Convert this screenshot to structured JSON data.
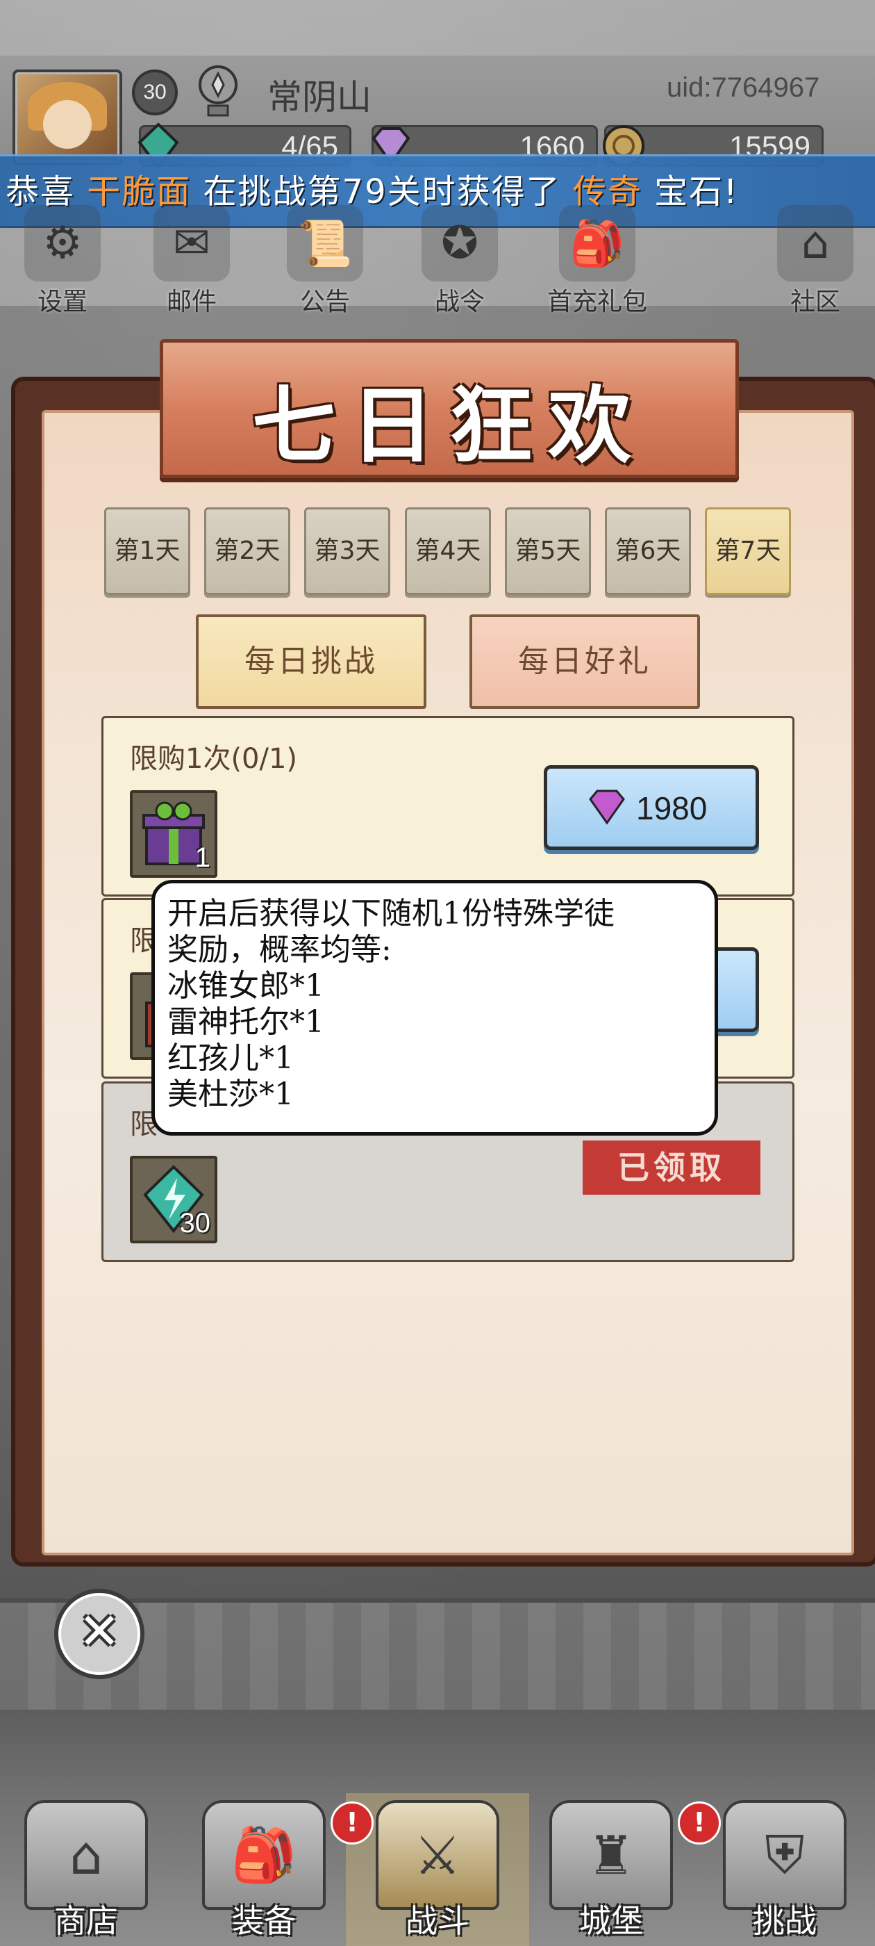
{
  "player": {
    "level": "30",
    "name": "常阴山",
    "uid": "uid:7764967"
  },
  "resources": {
    "energy": "4/65",
    "gems": "1660",
    "coins": "15599"
  },
  "banner": {
    "prefix": "恭喜 ",
    "player_name": "干脆面",
    "middle": " 在挑战第79关时获得了 ",
    "rarity": "传奇",
    "suffix": " 宝石!"
  },
  "top_menu": [
    {
      "label": "设置",
      "icon": "gear-icon"
    },
    {
      "label": "邮件",
      "icon": "mail-icon"
    },
    {
      "label": "公告",
      "icon": "scroll-icon"
    },
    {
      "label": "战令",
      "icon": "battle-pass-icon"
    },
    {
      "label": "首充礼包",
      "icon": "gift-bag-icon"
    },
    {
      "label": "社区",
      "icon": "home-icon"
    }
  ],
  "modal": {
    "title": "七日狂欢",
    "days": [
      "第1天",
      "第2天",
      "第3天",
      "第4天",
      "第5天",
      "第6天",
      "第7天"
    ],
    "active_day": "第7天",
    "subtabs": [
      "每日挑战",
      "每日好礼"
    ],
    "items": [
      {
        "title": "限购1次(0/1)",
        "count": "1",
        "price": "1980",
        "icon": "purple-gift-box-icon"
      },
      {
        "title": "限",
        "icon": "red-gift-box-icon"
      },
      {
        "title": "限",
        "count": "30",
        "status": "已领取",
        "icon": "energy-crystal-icon"
      }
    ]
  },
  "tooltip": {
    "lines": [
      "开启后获得以下随机1份特殊学徒",
      "奖励，概率均等:",
      "冰锥女郎*1",
      "雷神托尔*1",
      "红孩儿*1",
      "美杜莎*1"
    ]
  },
  "bottom_nav": [
    {
      "label": "商店",
      "icon": "shop-hut-icon"
    },
    {
      "label": "装备",
      "icon": "backpack-icon",
      "alert": "!"
    },
    {
      "label": "战斗",
      "icon": "crossed-swords-icon",
      "active": true
    },
    {
      "label": "城堡",
      "icon": "castle-hat-icon",
      "alert": "!"
    },
    {
      "label": "挑战",
      "icon": "shield-icon"
    }
  ],
  "colors": {
    "banner_highlight": "#ff9a3c",
    "modal_title_bg": "#d67f5e",
    "buy_button": "#9fcdf1",
    "claimed_stamp": "#c43a34"
  }
}
